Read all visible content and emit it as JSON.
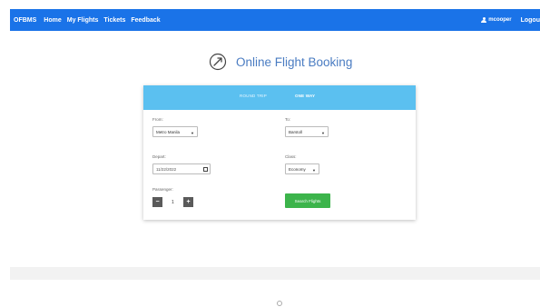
{
  "navbar": {
    "brand": "OFBMS",
    "links": [
      "Home",
      "My Flights",
      "Tickets",
      "Feedback"
    ],
    "user": "mcooper",
    "logout": "Logou"
  },
  "header": {
    "title": "Online Flight Booking",
    "icon": "plane-in-circle-icon"
  },
  "booking": {
    "tabs": [
      {
        "label": "ROUND TRIP",
        "active": false
      },
      {
        "label": "ONE WAY",
        "active": true
      }
    ],
    "from": {
      "label": "From:",
      "value": "Metro Manila"
    },
    "to": {
      "label": "To:",
      "value": "Barstoll"
    },
    "depart": {
      "label": "Depart:",
      "value": "11/22/2022"
    },
    "class": {
      "label": "Class:",
      "value": "Economy"
    },
    "passenger": {
      "label": "Passenger:",
      "value": "1",
      "minus": "−",
      "plus": "+"
    },
    "search_label": "Search Flights"
  },
  "colors": {
    "navbar": "#1a73e8",
    "tabs": "#5bc0f0",
    "search_button": "#3cb44b",
    "title": "#4a7cc2"
  }
}
